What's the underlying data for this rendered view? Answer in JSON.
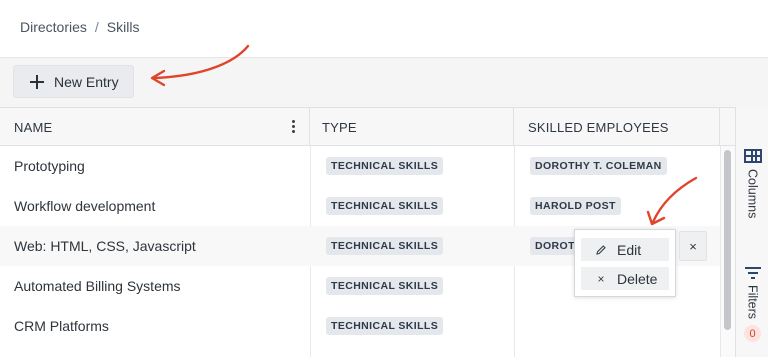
{
  "breadcrumb": {
    "items": [
      "Directories",
      "Skills"
    ],
    "separator": "/"
  },
  "toolbar": {
    "new_entry_label": "New Entry"
  },
  "table": {
    "columns": [
      "NAME",
      "TYPE",
      "SKILLED EMPLOYEES"
    ],
    "rows": [
      {
        "name": "Prototyping",
        "type": "TECHNICAL SKILLS",
        "employee": "DOROTHY T. COLEMAN"
      },
      {
        "name": "Workflow development",
        "type": "TECHNICAL SKILLS",
        "employee": "HAROLD POST"
      },
      {
        "name": "Web: HTML, CSS, Javascript",
        "type": "TECHNICAL SKILLS",
        "employee": "DOROT"
      },
      {
        "name": "Automated Billing Systems",
        "type": "TECHNICAL SKILLS",
        "employee": ""
      },
      {
        "name": "CRM Platforms",
        "type": "TECHNICAL SKILLS",
        "employee": ""
      }
    ]
  },
  "row_menu": {
    "edit_label": "Edit",
    "delete_label": "Delete",
    "close_label": "×"
  },
  "side_panel": {
    "columns_label": "Columns",
    "filters_label": "Filters",
    "filters_count": "0"
  },
  "colors": {
    "accent_arrow": "#e0452b",
    "badge_text": "#d2432f",
    "icon_blue": "#2c4670"
  }
}
